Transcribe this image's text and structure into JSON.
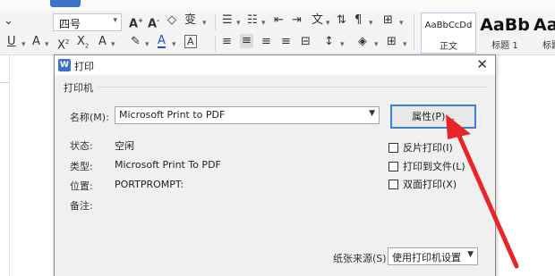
{
  "ribbon": {
    "font_size_value": "四号",
    "style_gallery": [
      {
        "sample": "AaBbCcDd",
        "name": "正文"
      },
      {
        "sample": "AaBb",
        "name": "标题 1"
      },
      {
        "sample": "AaB",
        "name": "标题"
      }
    ]
  },
  "dialog": {
    "title": "打印",
    "app_icon": "W",
    "group_label": "打印机",
    "name_label": "名称(M):",
    "printer_name": "Microsoft Print to PDF",
    "properties_button": "属性(P)...",
    "status_label": "状态:",
    "status_value": "空闲",
    "type_label": "类型:",
    "type_value": "Microsoft Print To PDF",
    "location_label": "位置:",
    "location_value": "PORTPROMPT:",
    "comment_label": "备注:",
    "checkboxes": [
      {
        "label": "反片打印(I)",
        "checked": false
      },
      {
        "label": "打印到文件(L)",
        "checked": false
      },
      {
        "label": "双面打印(X)",
        "checked": false
      }
    ],
    "paper_source_label": "纸张来源(S):",
    "paper_source_value": "使用打印机设置"
  },
  "colors": {
    "accent": "#3c72c8",
    "focus_border": "#3d7fd1",
    "annotation_arrow": "#e8262a"
  },
  "icons": {
    "close": "close-icon",
    "dropdown": "chevron-down-icon",
    "annotation": "red-arrow-annotation"
  }
}
